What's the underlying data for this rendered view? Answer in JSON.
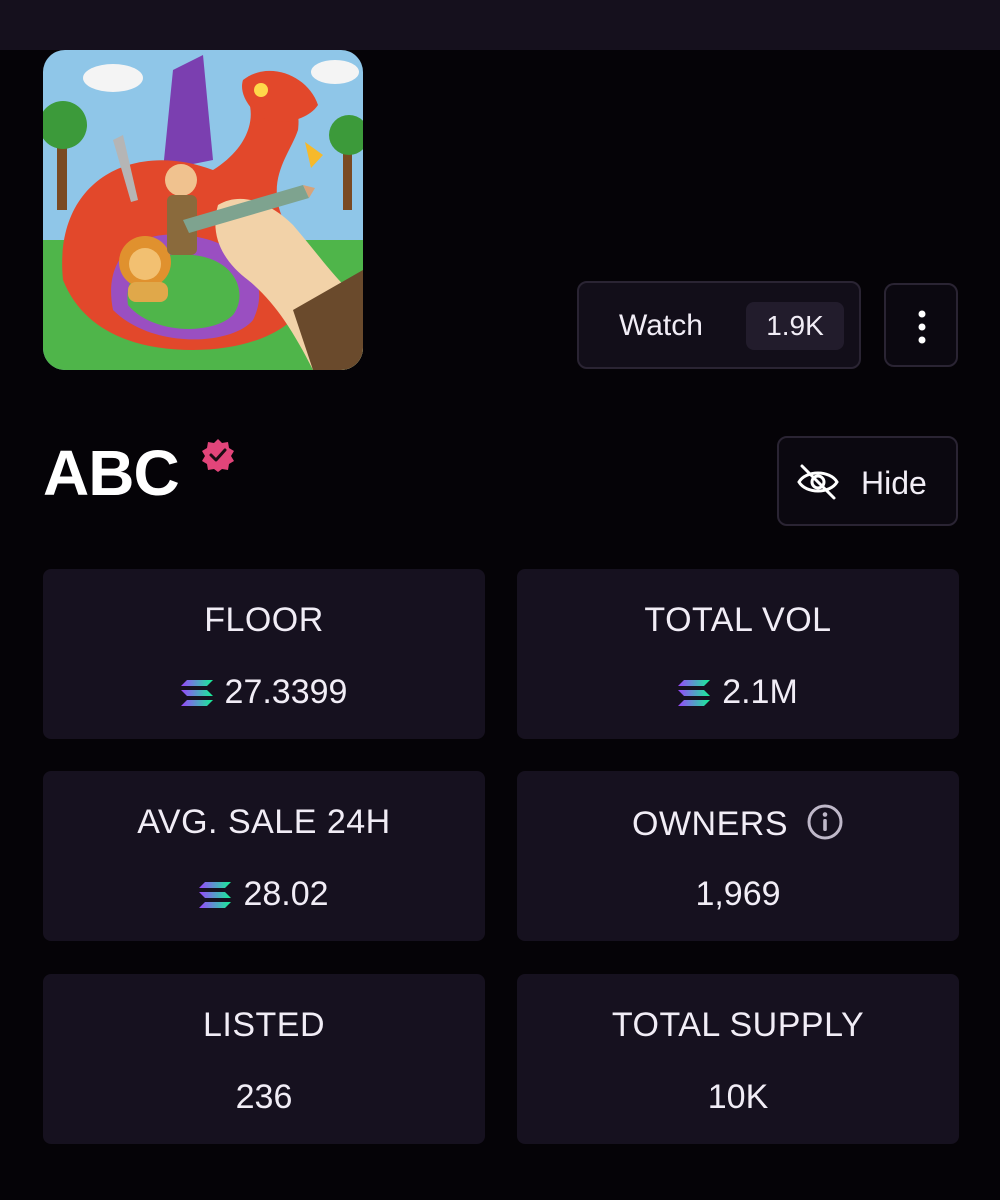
{
  "collection": {
    "name": "ABC",
    "verified": true
  },
  "actions": {
    "watch_label": "Watch",
    "watch_count": "1.9K",
    "hide_label": "Hide"
  },
  "stats": {
    "floor": {
      "label": "FLOOR",
      "value": "27.3399",
      "icon": "solana-icon"
    },
    "total_vol": {
      "label": "TOTAL VOL",
      "value": "2.1M",
      "icon": "solana-icon"
    },
    "avg_sale": {
      "label": "AVG. SALE 24H",
      "value": "28.02",
      "icon": "solana-icon"
    },
    "owners": {
      "label": "OWNERS",
      "value": "1,969",
      "icon": "info-icon"
    },
    "listed": {
      "label": "LISTED",
      "value": "236"
    },
    "total_supply": {
      "label": "TOTAL SUPPLY",
      "value": "10K"
    }
  },
  "colors": {
    "background": "#050307",
    "card": "#16111f",
    "verified_badge": "#e2457a"
  }
}
